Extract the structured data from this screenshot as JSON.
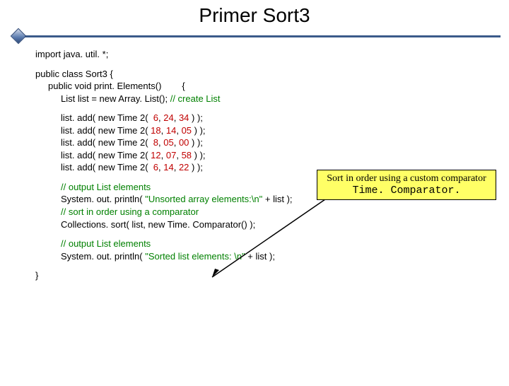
{
  "title": "Primer Sort3",
  "code": {
    "import": "import java. util. *;",
    "class_decl": "public class Sort3 {",
    "method_decl_a": "public void print. Elements()",
    "method_decl_b": "{",
    "list_decl_a": "List list = new Array. List(); ",
    "list_decl_cmt": "// create List",
    "adds": [
      {
        "pre": "list. add( new Time 2(  ",
        "h": "6",
        "sep1": ", ",
        "m": "24",
        "sep2": ", ",
        "s": "34",
        "post": " ) );"
      },
      {
        "pre": "list. add( new Time 2( ",
        "h": "18",
        "sep1": ", ",
        "m": "14",
        "sep2": ", ",
        "s": "05",
        "post": " ) );"
      },
      {
        "pre": "list. add( new Time 2(  ",
        "h": "8",
        "sep1": ", ",
        "m": "05",
        "sep2": ", ",
        "s": "00",
        "post": " ) );"
      },
      {
        "pre": "list. add( new Time 2( ",
        "h": "12",
        "sep1": ", ",
        "m": "07",
        "sep2": ", ",
        "s": "58",
        "post": " ) );"
      },
      {
        "pre": "list. add( new Time 2(  ",
        "h": "6",
        "sep1": ", ",
        "m": "14",
        "sep2": ", ",
        "s": "22",
        "post": " ) );"
      }
    ],
    "out1_cmt": "// output List elements",
    "out1_a": "System. out. println( ",
    "out1_str": "\"Unsorted array elements:\\n\"",
    "out1_b": " + list );",
    "sort_cmt": "// sort in order using a comparator",
    "sort_line": "Collections. sort( list, new Time. Comparator() );",
    "out2_cmt": "// output List elements",
    "out2_a": "System. out. println( ",
    "out2_str": "\"Sorted list elements: \\n\"",
    "out2_b": " + list );",
    "close": "}"
  },
  "callout": {
    "line1": "Sort in order using a custom comparator",
    "line2": "Time. Comparator."
  }
}
